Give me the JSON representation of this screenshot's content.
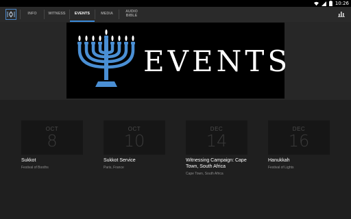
{
  "status_bar": {
    "time": "10:26",
    "icons": [
      "wifi-icon",
      "signal-icon",
      "battery-icon"
    ]
  },
  "app": {
    "logo_icon": "app-logo-icon",
    "accent_color": "#3b8ad9"
  },
  "tabs": [
    {
      "label": "INFO",
      "active": false
    },
    {
      "label": "WITNESS",
      "active": false
    },
    {
      "label": "EVENTS",
      "active": true
    },
    {
      "label": "MEDIA",
      "active": false
    },
    {
      "label": "AUDIO\nBIBLE",
      "active": false
    }
  ],
  "toolbar": {
    "chart_icon": "bar-chart-icon"
  },
  "banner": {
    "title": "EVENTS",
    "image_icon": "menorah-icon"
  },
  "events": [
    {
      "month": "OCT",
      "day": "8",
      "title": "Sukkot",
      "subtitle": "Festival of Booths"
    },
    {
      "month": "OCT",
      "day": "10",
      "title": "Sukkot Service",
      "subtitle": "Paris, France"
    },
    {
      "month": "DEC",
      "day": "14",
      "title": "Witnessing Campaign: Cape Town, South Africa",
      "subtitle": "Cape Town, South Africa"
    },
    {
      "month": "DEC",
      "day": "16",
      "title": "Hanukkah",
      "subtitle": "Festival of Lights"
    }
  ]
}
